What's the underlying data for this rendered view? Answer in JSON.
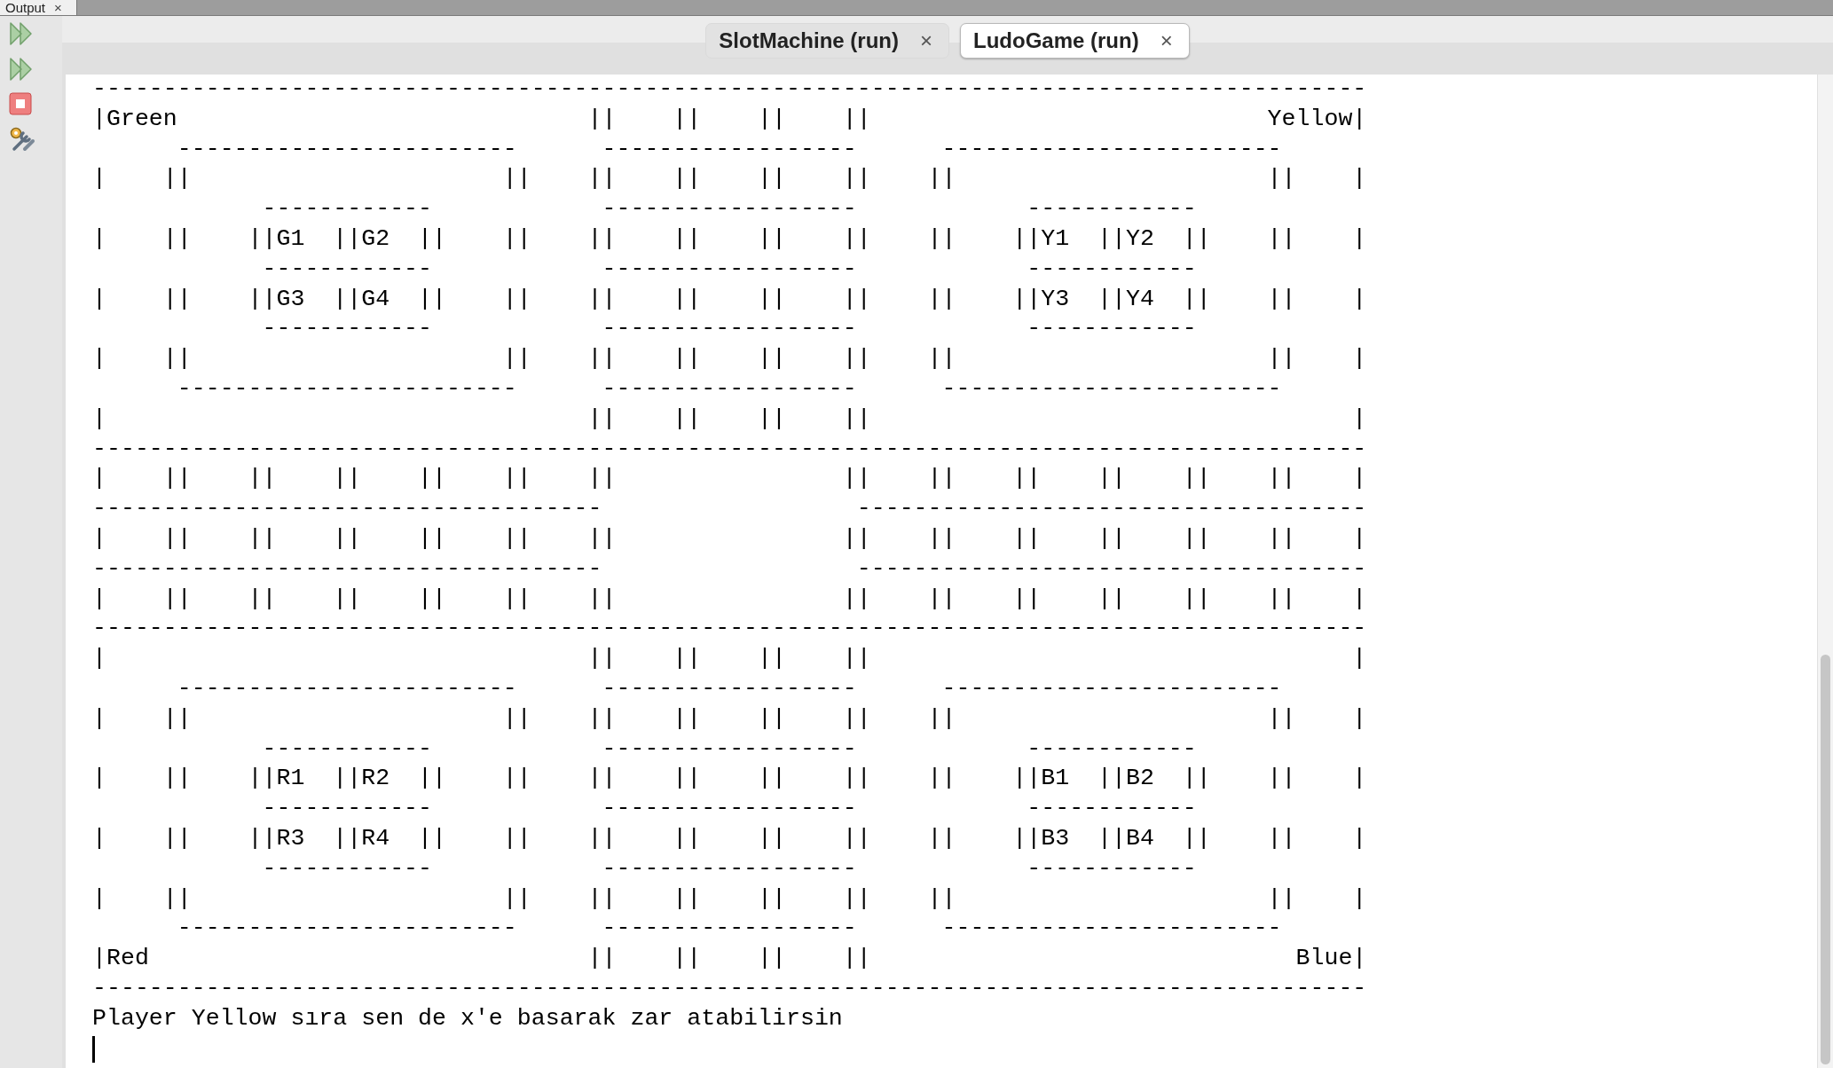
{
  "top_tab": {
    "label": "Output",
    "close": "×"
  },
  "toolbar": [
    {
      "kind": "double-play"
    },
    {
      "kind": "double-play"
    },
    {
      "kind": "stop"
    },
    {
      "kind": "tools"
    }
  ],
  "tabs": [
    {
      "label": "SlotMachine (run)",
      "close": "×",
      "selected": false
    },
    {
      "label": "LudoGame (run)",
      "close": "×",
      "selected": true
    }
  ],
  "output": {
    "lines": [
      "------------------------------------------------------------------------------------------",
      "|Green                             ||    ||    ||    ||                            Yellow|",
      "      ------------------------      ------------------      ------------------------",
      "|    ||                      ||    ||    ||    ||    ||    ||                      ||    |",
      "            ------------            ------------------            ------------",
      "|    ||    ||G1  ||G2  ||    ||    ||    ||    ||    ||    ||    ||Y1  ||Y2  ||    ||    |",
      "            ------------            ------------------            ------------",
      "|    ||    ||G3  ||G4  ||    ||    ||    ||    ||    ||    ||    ||Y3  ||Y4  ||    ||    |",
      "            ------------            ------------------            ------------",
      "|    ||                      ||    ||    ||    ||    ||    ||                      ||    |",
      "      ------------------------      ------------------      ------------------------",
      "|                                  ||    ||    ||    ||                                  |",
      "------------------------------------------------------------------------------------------",
      "|    ||    ||    ||    ||    ||    ||                ||    ||    ||    ||    ||    ||    |",
      "------------------------------------                  ------------------------------------",
      "|    ||    ||    ||    ||    ||    ||                ||    ||    ||    ||    ||    ||    |",
      "------------------------------------                  ------------------------------------",
      "|    ||    ||    ||    ||    ||    ||                ||    ||    ||    ||    ||    ||    |",
      "------------------------------------------------------------------------------------------",
      "|                                  ||    ||    ||    ||                                  |",
      "      ------------------------      ------------------      ------------------------",
      "|    ||                      ||    ||    ||    ||    ||    ||                      ||    |",
      "            ------------            ------------------            ------------",
      "|    ||    ||R1  ||R2  ||    ||    ||    ||    ||    ||    ||    ||B1  ||B2  ||    ||    |",
      "            ------------            ------------------            ------------",
      "|    ||    ||R3  ||R4  ||    ||    ||    ||    ||    ||    ||    ||B3  ||B4  ||    ||    |",
      "            ------------            ------------------            ------------",
      "|    ||                      ||    ||    ||    ||    ||    ||                      ||    |",
      "      ------------------------      ------------------      ------------------------",
      "|Red                               ||    ||    ||    ||                              Blue|",
      "------------------------------------------------------------------------------------------",
      "Player Yellow sıra sen de x'e basarak zar atabilirsin"
    ],
    "cursor": true
  }
}
